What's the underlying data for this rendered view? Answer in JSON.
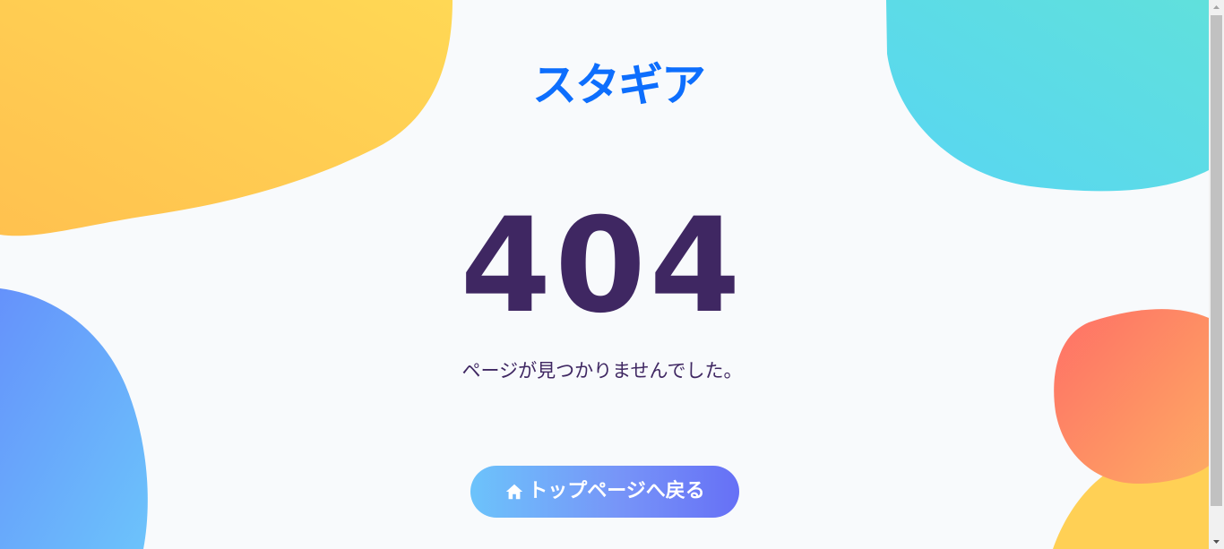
{
  "brand": {
    "logo_text": "スタギア",
    "logo_color": "#0d6efd"
  },
  "error": {
    "code": "404",
    "message": "ページが見つかりませんでした。",
    "text_color": "#3f2762"
  },
  "actions": {
    "home_button_label": "トップページへ戻る",
    "home_button_icon": "home-icon"
  },
  "theme": {
    "background": "#f8fafc",
    "blob_colors": {
      "top_left": [
        "#ffc14f",
        "#ffd855"
      ],
      "top_right": [
        "#58d6f2",
        "#60e0dc"
      ],
      "bottom_left": [
        "#6592fb",
        "#6cc3fb"
      ],
      "bottom_right_coral": [
        "#ff6f66",
        "#fdab63"
      ],
      "bottom_right_yellow": [
        "#ffc14f",
        "#ffd855"
      ]
    }
  }
}
